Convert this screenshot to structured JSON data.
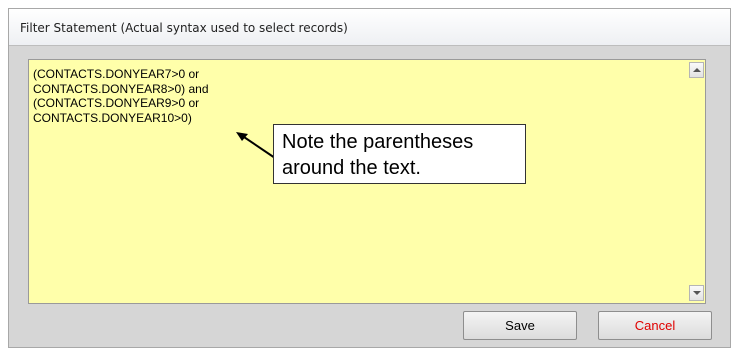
{
  "window": {
    "title": "Filter Statement (Actual syntax used to select records)"
  },
  "filter": {
    "text": "(CONTACTS.DONYEAR7>0 or\nCONTACTS.DONYEAR8>0) and\n(CONTACTS.DONYEAR9>0 or\nCONTACTS.DONYEAR10>0)",
    "background_color": "#ffffaa"
  },
  "callout": {
    "line1": "Note the parentheses",
    "line2": "around the text."
  },
  "buttons": {
    "save_label": "Save",
    "cancel_label": "Cancel",
    "cancel_color": "#e00000"
  },
  "icons": {
    "scroll_up": "scroll-up-arrow-icon",
    "scroll_down": "scroll-down-arrow-icon",
    "callout_arrow": "arrow-icon"
  }
}
